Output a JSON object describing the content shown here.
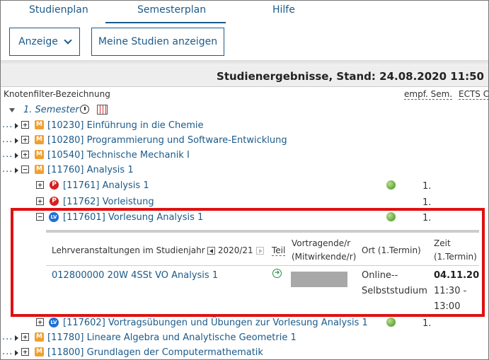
{
  "tabs": [
    {
      "label": "Studienplan"
    },
    {
      "label": "Semesterplan"
    },
    {
      "label": "Hilfe"
    }
  ],
  "toolbar": {
    "anzeige_label": "Anzeige",
    "meine_studien_label": "Meine Studien anzeigen"
  },
  "results": {
    "title": "Studienergebnisse, Stand: 24.08.2020 11:50"
  },
  "columns": {
    "knoten": "Knotenfilter-Bezeichnung",
    "sem": "empf. Sem.",
    "ects": "ECTS Cr"
  },
  "semester": {
    "label": "1. Semester"
  },
  "tree": [
    {
      "text": "[10230] Einführung in die Chemie",
      "badge": "M"
    },
    {
      "text": "[10280] Programmierung und Software-Entwicklung",
      "badge": "M"
    },
    {
      "text": "[10540] Technische Mechanik I",
      "badge": "M"
    },
    {
      "text": "[11760] Analysis 1",
      "badge": "M"
    },
    {
      "text": "[11761] Analysis 1",
      "badge": "P",
      "sem": "1."
    },
    {
      "text": "[11762] Vorleistung",
      "badge": "P",
      "sem": "1."
    },
    {
      "text": "[117601] Vorlesung Analysis 1",
      "badge": "LV",
      "sem": "1."
    },
    {
      "text": "[117602] Vortragsübungen und Übungen zur Vorlesung Analysis 1",
      "badge": "LV",
      "sem": "1."
    },
    {
      "text": "[11780] Lineare Algebra und Analytische Geometrie 1",
      "badge": "M"
    },
    {
      "text": "[11800] Grundlagen der Computermathematik",
      "badge": "M"
    }
  ],
  "subpanel": {
    "lv_header": "Lehrveranstaltungen im Studienjahr",
    "year": "2020/21",
    "teil": "Teil",
    "vortragende_1": "Vortragende/r",
    "vortragende_2": "(Mitwirkende/r)",
    "ort": "Ort (1.Termin)",
    "zeit_1": "Zeit",
    "zeit_2": "(1.Termin)",
    "course": "012800000 20W 4SSt VO Analysis 1",
    "ort_val_1": "Online--",
    "ort_val_2": "Selbststudium",
    "date": "04.11.20",
    "time_1": "11:30 -",
    "time_2": "13:00"
  }
}
